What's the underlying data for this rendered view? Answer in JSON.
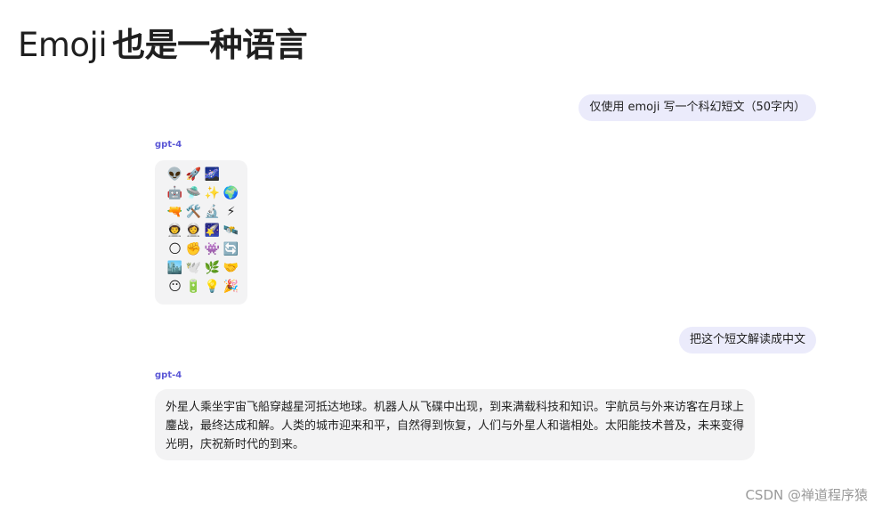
{
  "page": {
    "title_emoji_word": "Emoji",
    "title_rest": "也是一种语言"
  },
  "conversation": {
    "messages": [
      {
        "role": "user",
        "text": "仅使用 emoji 写一个科幻短文（50字内）"
      },
      {
        "role": "assistant",
        "model": "gpt-4",
        "emoji_rows": [
          [
            "👽",
            "🚀",
            "🌌"
          ],
          [
            "🤖",
            "🛸",
            "✨",
            "🌍"
          ],
          [
            "🔫",
            "🛠️",
            "🔬",
            "⚡"
          ],
          [
            "👨‍🚀",
            "👩‍🚀",
            "🌠",
            "🛰️"
          ],
          [
            "🌕",
            "✊",
            "👾",
            "🔄"
          ],
          [
            "🏙️",
            "🕊️",
            "🌿",
            "🤝"
          ],
          [
            "😶",
            "🔋",
            "💡",
            "🎉"
          ]
        ]
      },
      {
        "role": "user",
        "text": "把这个短文解读成中文"
      },
      {
        "role": "assistant",
        "model": "gpt-4",
        "text": "外星人乘坐宇宙飞船穿越星河抵达地球。机器人从飞碟中出现，到来满载科技和知识。宇航员与外来访客在月球上鏖战，最终达成和解。人类的城市迎来和平，自然得到恢复，人们与外星人和谐相处。太阳能技术普及，未来变得光明，庆祝新时代的到来。"
      }
    ]
  },
  "watermark": "CSDN @禅道程序猿"
}
